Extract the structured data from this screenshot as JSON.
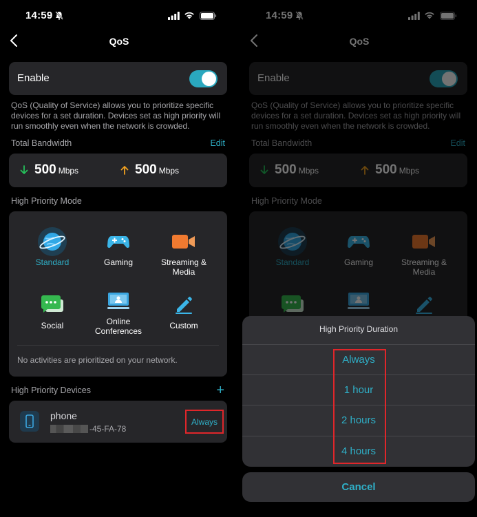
{
  "status": {
    "time": "14:59"
  },
  "nav": {
    "title": "QoS"
  },
  "enable": {
    "label": "Enable",
    "on": true
  },
  "description": "QoS (Quality of Service) allows you to prioritize specific devices for a set duration. Devices set as high priority will run smoothly even when the network is crowded.",
  "bandwidth": {
    "section_label": "Total Bandwidth",
    "edit_label": "Edit",
    "download": {
      "value": "500",
      "unit": "Mbps"
    },
    "upload": {
      "value": "500",
      "unit": "Mbps"
    }
  },
  "priority_mode": {
    "section_label": "High Priority Mode",
    "modes": [
      {
        "label": "Standard",
        "icon": "planet-icon",
        "selected": true
      },
      {
        "label": "Gaming",
        "icon": "gamepad-icon"
      },
      {
        "label": "Streaming & Media",
        "icon": "video-camera-icon"
      },
      {
        "label": "Social",
        "icon": "chat-icon"
      },
      {
        "label": "Online Conferences",
        "icon": "conference-icon"
      },
      {
        "label": "Custom",
        "icon": "pencil-icon"
      }
    ],
    "empty_message": "No activities are prioritized on your network."
  },
  "devices": {
    "section_label": "High Priority Devices",
    "list": [
      {
        "name": "phone",
        "mac_suffix": "-45-FA-78",
        "duration": "Always"
      }
    ]
  },
  "duration_sheet": {
    "title": "High Priority Duration",
    "options": [
      "Always",
      "1 hour",
      "2 hours",
      "4 hours"
    ],
    "cancel_label": "Cancel"
  },
  "colors": {
    "accent": "#2fb0c8",
    "highlight_box": "#e0262a",
    "download_arrow": "#25c05a",
    "upload_arrow": "#f0a020"
  }
}
